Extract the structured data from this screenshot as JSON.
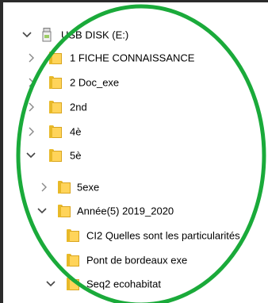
{
  "tree": {
    "items": [
      {
        "label": "USB DISK (E:)",
        "chevron": "expanded",
        "icon": "usb-drive-icon"
      },
      {
        "label": "1 FICHE CONNAISSANCE",
        "chevron": "collapsed",
        "icon": "folder-icon"
      },
      {
        "label": "2 Doc_exe",
        "chevron": "collapsed",
        "icon": "folder-icon"
      },
      {
        "label": "2nd",
        "chevron": "collapsed",
        "icon": "folder-icon"
      },
      {
        "label": "4è",
        "chevron": "collapsed",
        "icon": "folder-icon"
      },
      {
        "label": "5è",
        "chevron": "expanded",
        "icon": "folder-icon"
      },
      {
        "label": "5exe",
        "chevron": "collapsed",
        "icon": "folder-icon"
      },
      {
        "label": "Année(5) 2019_2020",
        "chevron": "expanded",
        "icon": "folder-icon"
      },
      {
        "label": "CI2 Quelles sont les particularités",
        "chevron": "none",
        "icon": "folder-icon"
      },
      {
        "label": "Pont de bordeaux exe",
        "chevron": "none",
        "icon": "folder-icon"
      },
      {
        "label": "Seq2 ecohabitat",
        "chevron": "expanded",
        "icon": "folder-icon"
      }
    ]
  },
  "colors": {
    "highlight_circle": "#1aaa3a",
    "folder": "#ffd45a",
    "chevron": "#6b6b6b"
  }
}
